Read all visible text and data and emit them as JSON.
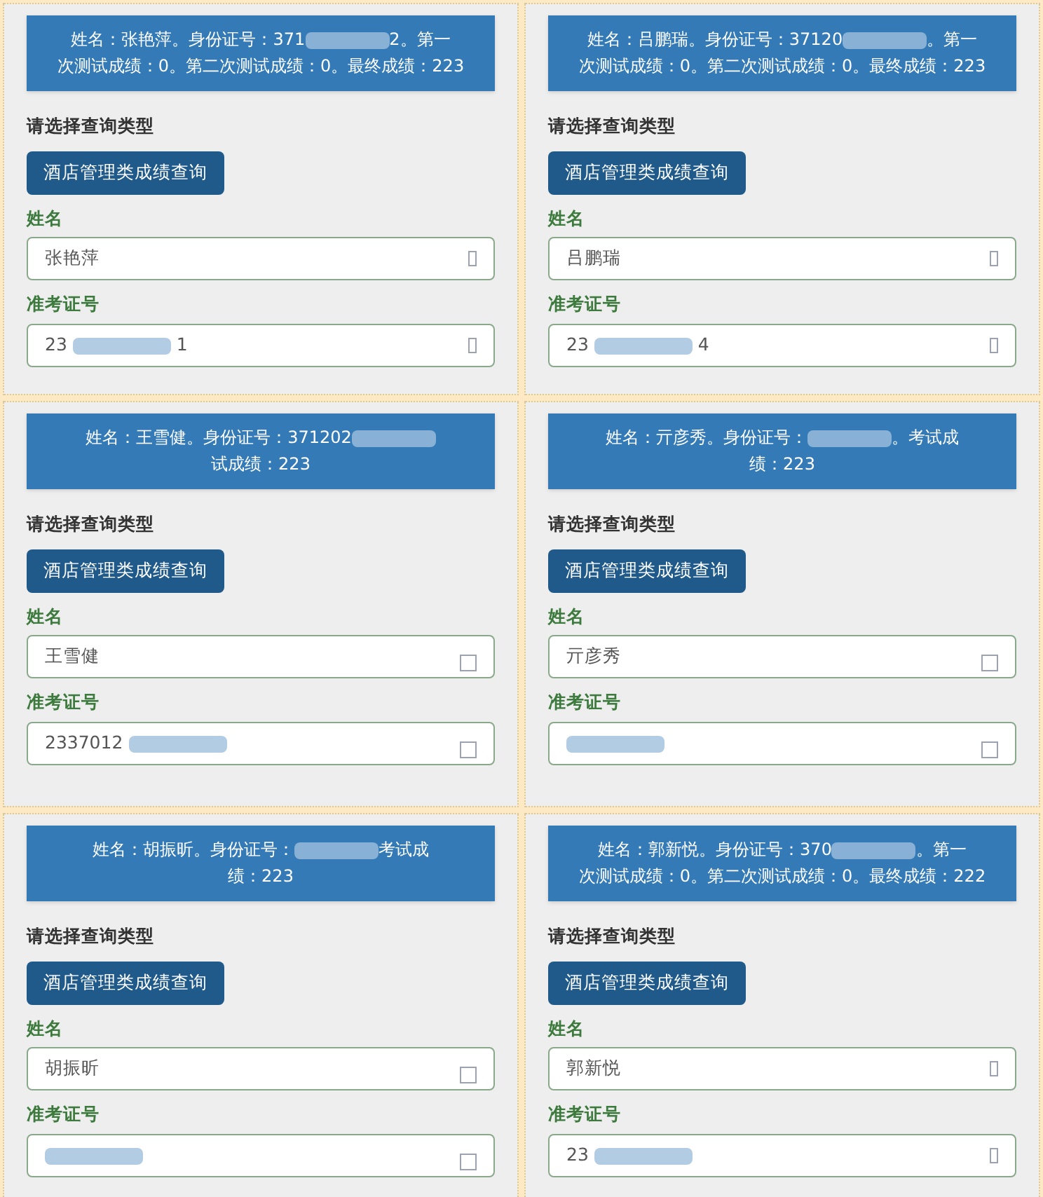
{
  "panels": [
    {
      "banner": {
        "before": "姓名：张艳萍。身份证号：371",
        "after": "2。第一",
        "line2": "次测试成绩：0。第二次测试成绩：0。最终成绩：223"
      },
      "type_label": "请选择查询类型",
      "type_button": "酒店管理类成绩查询",
      "fields": [
        {
          "label": "姓名",
          "value_before": "张艳萍",
          "kind": "glyph"
        },
        {
          "label": "准考证号",
          "value_before": "23",
          "value_after": "1",
          "kind": "glyph"
        }
      ]
    },
    {
      "banner": {
        "before": "姓名：吕鹏瑞。身份证号：37120",
        "after": "。第一",
        "line2": "次测试成绩：0。第二次测试成绩：0。最终成绩：223"
      },
      "type_label": "请选择查询类型",
      "type_button": "酒店管理类成绩查询",
      "fields": [
        {
          "label": "姓名",
          "value_before": "吕鹏瑞",
          "kind": "glyph"
        },
        {
          "label": "准考证号",
          "value_before": "23",
          "value_after": "4",
          "kind": "glyph"
        }
      ]
    },
    {
      "banner": {
        "before": "姓名：王雪健。身份证号：371202",
        "line2": "试成绩：223"
      },
      "type_label": "请选择查询类型",
      "type_button": "酒店管理类成绩查询",
      "fields": [
        {
          "label": "姓名",
          "value_before": "王雪健",
          "kind": "box"
        },
        {
          "label": "准考证号",
          "value_before": "2337012",
          "kind": "box"
        }
      ]
    },
    {
      "banner": {
        "before": "姓名：亓彦秀。身份证号：",
        "after": "。考试成",
        "line2": "绩：223"
      },
      "type_label": "请选择查询类型",
      "type_button": "酒店管理类成绩查询",
      "fields": [
        {
          "label": "姓名",
          "value_before": "亓彦秀",
          "kind": "box"
        },
        {
          "label": "准考证号",
          "kind": "box"
        }
      ]
    },
    {
      "banner": {
        "before": "姓名：胡振昕。身份证号：",
        "after": "考试成",
        "line2": "绩：223"
      },
      "type_label": "请选择查询类型",
      "type_button": "酒店管理类成绩查询",
      "fields": [
        {
          "label": "姓名",
          "value_before": "胡振昕",
          "kind": "box"
        },
        {
          "label": "准考证号",
          "kind": "box"
        }
      ]
    },
    {
      "banner": {
        "before": "姓名：郭新悦。身份证号：370",
        "after": "。第一",
        "line2": "次测试成绩：0。第二次测试成绩：0。最终成绩：222"
      },
      "type_label": "请选择查询类型",
      "type_button": "酒店管理类成绩查询",
      "fields": [
        {
          "label": "姓名",
          "value_before": "郭新悦",
          "kind": "glyph"
        },
        {
          "label": "准考证号",
          "value_before": "23",
          "kind": "glyph"
        }
      ]
    }
  ]
}
